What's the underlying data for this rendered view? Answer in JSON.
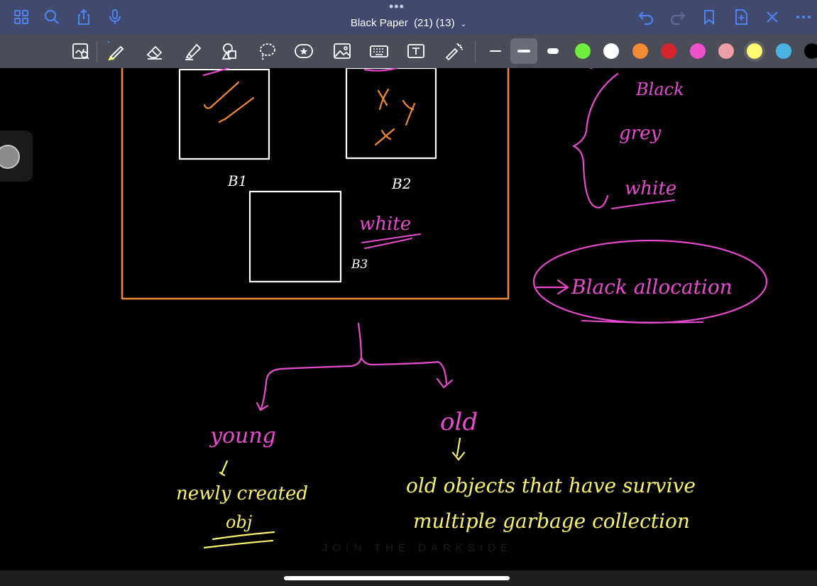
{
  "document": {
    "title": "Black Paper",
    "count": "(21) (13)",
    "menu_caret": "⌄"
  },
  "topbar": {
    "left_icons": [
      "grid-icon",
      "search-icon",
      "share-icon",
      "microphone-icon"
    ],
    "right_icons": [
      "undo-icon",
      "redo-icon",
      "bookmark-icon",
      "add-page-icon",
      "close-icon",
      "more-icon"
    ]
  },
  "toolbar": {
    "tools": [
      "zoom-window-icon",
      "pen-icon",
      "eraser-icon",
      "highlighter-icon",
      "shapes-icon",
      "lasso-icon",
      "sticker-icon",
      "image-icon",
      "keyboard-icon",
      "text-box-icon",
      "laser-pointer-icon"
    ],
    "stroke_sizes": [
      "thin",
      "medium",
      "thick"
    ],
    "selected_stroke": "medium",
    "colors": [
      "#6cf040",
      "#ffffff",
      "#f08a34",
      "#d8242b",
      "#ee4fcb",
      "#ef9ea6",
      "#fffb6f",
      "#4ab3e4",
      "#000000"
    ],
    "selected_color": "#fffb6f"
  },
  "ink": {
    "block_labels": [
      "B1",
      "B2",
      "B3"
    ],
    "annotation_white": "white",
    "legend": [
      "Black",
      "grey",
      "white"
    ],
    "circled_note": "Black allocation",
    "branch_young": "young",
    "branch_old": "old",
    "young_desc_1": "newly created",
    "young_desc_2": "obj",
    "old_desc_1": "old objects that have survive",
    "old_desc_2": "multiple garbage collection",
    "watermark": "JOIN THE DARKSIDE"
  },
  "colors": {
    "topbar": "#414a6e",
    "toolbar": "#4a4c57",
    "accent_blue": "#4b84f0",
    "ink_pink": "#e94bd0",
    "ink_yellow": "#fbf36a",
    "ink_orange": "#f08a34"
  }
}
